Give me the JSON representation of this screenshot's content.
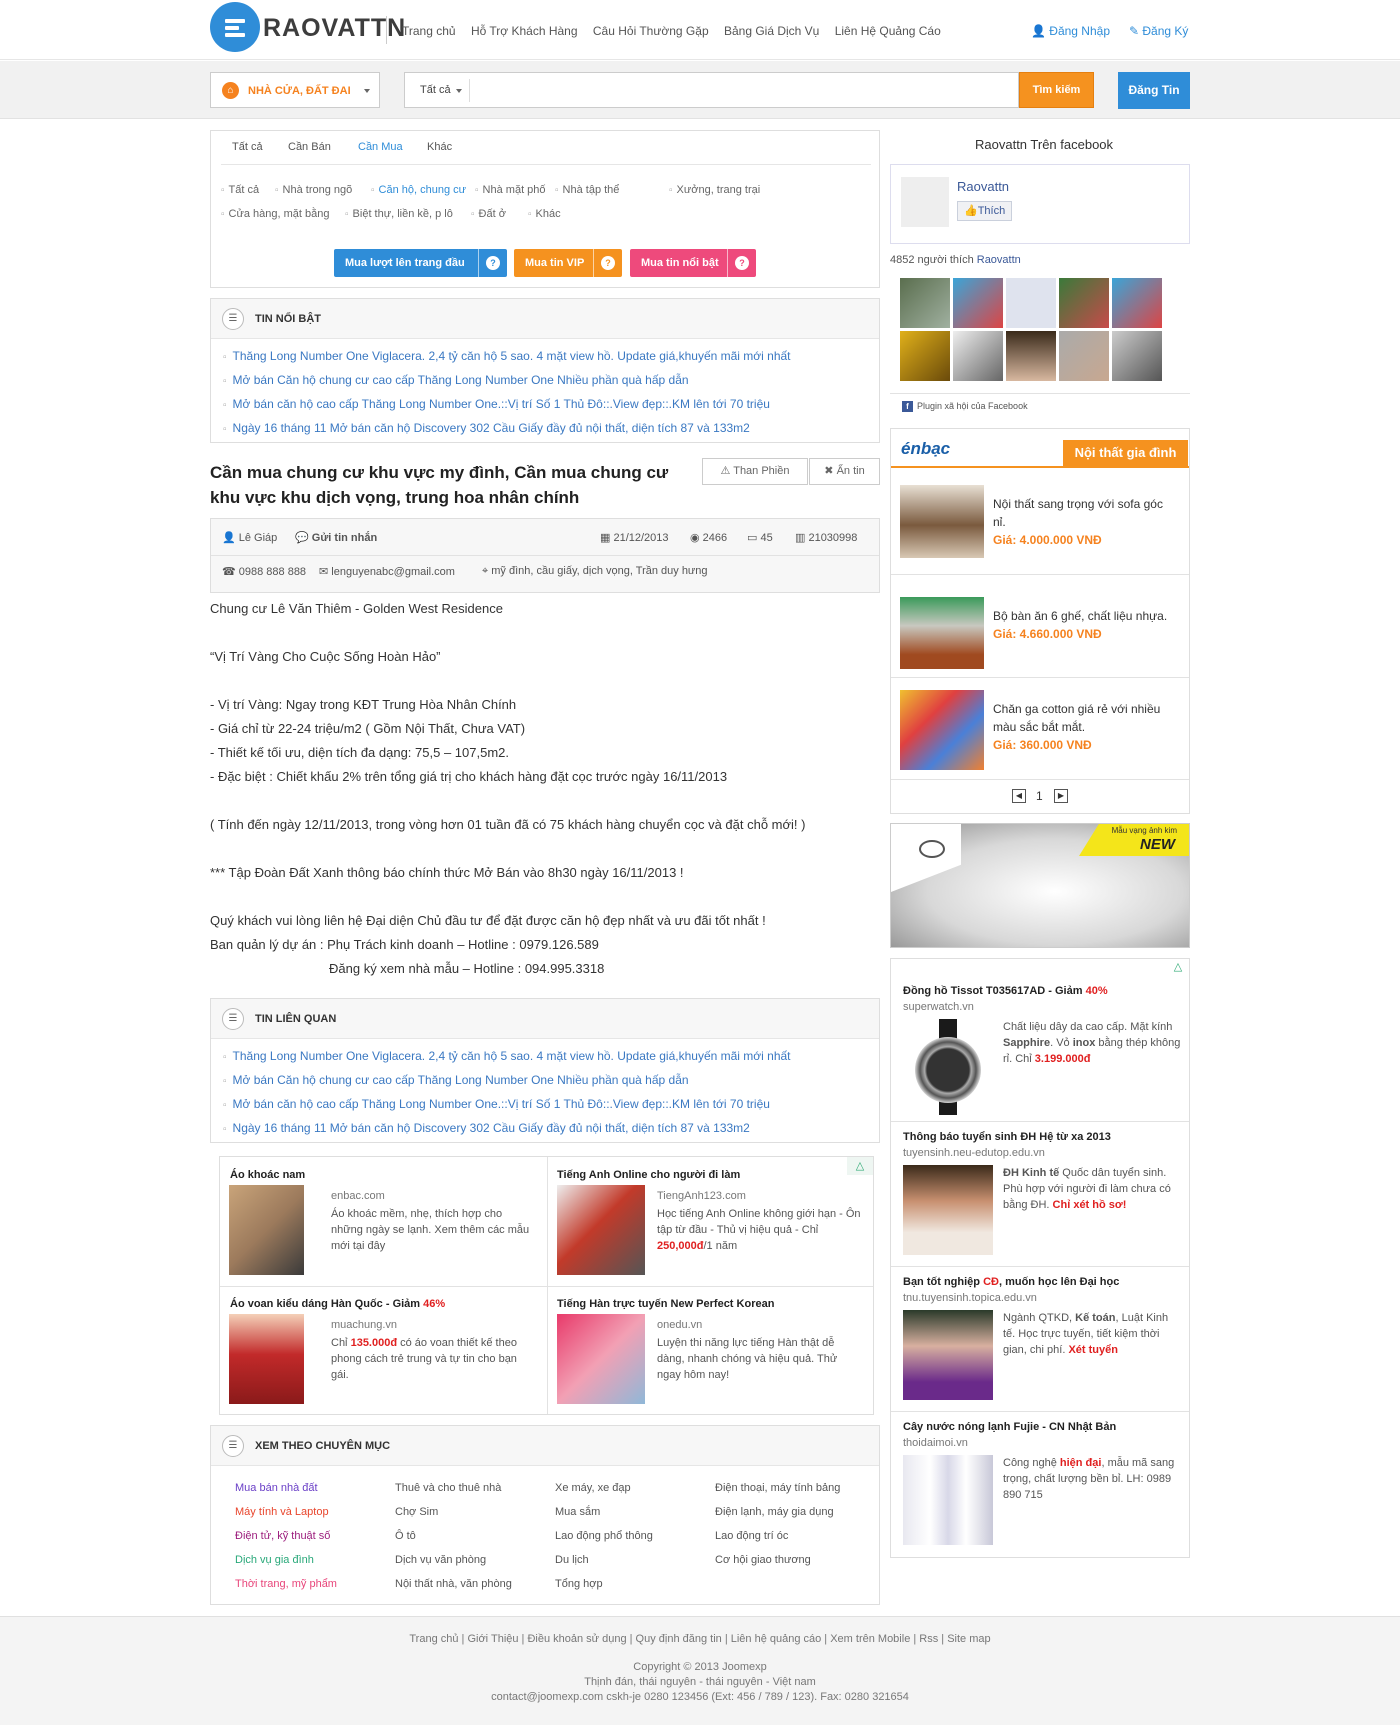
{
  "header": {
    "brand": "RAOVATTN",
    "nav": [
      "Trang chủ",
      "Hỗ Trợ Khách Hàng",
      "Câu Hỏi Thường Gặp",
      "Bảng Giá Dịch Vụ",
      "Liên Hệ Quảng Cáo"
    ],
    "login": "Đăng Nhập",
    "register": "Đăng Ký"
  },
  "search": {
    "category": "NHÀ CỬA, ĐẤT ĐAI",
    "scope": "Tất cả",
    "placeholder": "",
    "button": "Tìm kiếm",
    "post_button": "Đăng Tin"
  },
  "filters": {
    "tabs": [
      "Tất cả",
      "Cần Bán",
      "Cần Mua",
      "Khác"
    ],
    "active_tab": "Cần Mua",
    "chips": [
      "Tất cả",
      "Nhà trong ngõ",
      "Căn hộ, chung cư",
      "Nhà mặt phố",
      "Nhà tập thể",
      "Xưởng, trang trại",
      "Cửa hàng, mặt bằng",
      "Biệt thự, liền kề, p lô",
      "Đất ở",
      "Khác"
    ],
    "active_chip": "Căn hộ, chung cư",
    "actions": [
      "Mua lượt lên trang đầu",
      "Mua tin VIP",
      "Mua tin nổi bật"
    ]
  },
  "featured": {
    "title": "TIN NỔI BẬT",
    "items": [
      "Thăng Long Number One Viglacera. 2,4 tỷ căn hộ 5 sao. 4 mặt view hồ. Update giá,khuyến mãi mới nhất",
      "Mở bán Căn hộ chung cư cao cấp Thăng Long Number One Nhiều phần quà hấp dẫn",
      "Mở bán căn hộ cao cấp Thăng Long Number One.::Vị trí Số 1 Thủ Đô::.View đẹp::.KM lên tới 70 triệu",
      "Ngày 16 tháng 11 Mở bán căn hộ Discovery 302 Cầu Giấy đầy đủ nội thất, diện tích 87 và 133m2"
    ]
  },
  "post": {
    "title": "Cần mua chung cư khu vực my đình, Cần mua chung cư khu vực khu dịch vọng, trung hoa nhân chính",
    "complain": "Than Phiền",
    "hide": "Ẩn tin",
    "author": "Lê Giáp",
    "message": "Gửi tin nhắn",
    "date": "21/12/2013",
    "views": "2466",
    "comments": "45",
    "id": "21030998",
    "phone": "0988 888 888",
    "email": "lenguyenabc@gmail.com",
    "location": "mỹ đình, cầu giấy, dịch vọng, Trần duy hưng",
    "body": [
      "Chung cư Lê Văn Thiêm - Golden West Residence",
      "“Vị Trí Vàng Cho Cuộc Sống Hoàn Hảo”",
      "- Vị trí Vàng: Ngay trong KĐT Trung Hòa Nhân Chính",
      "- Giá chỉ từ 22-24 triệu/m2 ( Gồm Nội Thất, Chưa VAT)",
      "- Thiết kế tối ưu, diện tích đa dạng: 75,5 – 107,5m2.",
      "- Đặc biệt : Chiết khấu 2% trên tổng giá trị cho khách hàng đặt cọc trước ngày 16/11/2013",
      "( Tính đến ngày 12/11/2013, trong vòng hơn 01 tuần  đã có 75 khách hàng chuyển cọc và đặt chỗ mới! )",
      "*** Tập Đoàn Đất Xanh thông báo chính thức Mở Bán vào 8h30 ngày 16/11/2013 !",
      "Quý khách vui lòng liên hệ Đại diện Chủ đầu tư để đặt được căn hộ đẹp nhất và ưu đãi tốt nhất !",
      "Ban quản lý dự án :  Phụ Trách kinh doanh – Hotline :   0979.126.589",
      "Đăng ký xem nhà mẫu – Hotline :   094.995.3318"
    ]
  },
  "related": {
    "title": "TIN LIÊN QUAN",
    "items": [
      "Thăng Long Number One Viglacera. 2,4 tỷ căn hộ 5 sao. 4 mặt view hồ. Update giá,khuyến mãi mới nhất",
      "Mở bán Căn hộ chung cư cao cấp Thăng Long Number One Nhiều phần quà hấp dẫn",
      "Mở bán căn hộ cao cấp Thăng Long Number One.::Vị trí Số 1 Thủ Đô::.View đẹp::.KM lên tới 70 triệu",
      "Ngày 16 tháng 11 Mở bán căn hộ Discovery 302 Cầu Giấy đầy đủ nội thất, diện tích 87 và 133m2"
    ]
  },
  "ads": [
    {
      "title": "Áo khoác nam",
      "url": "enbac.com",
      "text": "Áo khoác mềm, nhẹ, thích hợp cho những ngày se lạnh. Xem thêm các mẫu mới tại đây"
    },
    {
      "title": "Tiếng Anh Online cho người đi làm",
      "url": "TiengAnh123.com",
      "text": "Học tiếng Anh Online không giới hạn - Ôn tập từ đầu - Thủ vị hiệu quả - Chỉ",
      "hl": "250,000đ",
      "tail": "/1 năm"
    },
    {
      "title": "Áo voan kiểu dáng Hàn Quốc - Giảm",
      "badge": "46%",
      "url": "muachung.vn",
      "pre": "Chỉ",
      "hl": "135.000đ",
      "text": "có áo voan thiết kế theo phong cách trẻ trung và tự tin cho bạn gái."
    },
    {
      "title": "Tiếng Hàn trực tuyến New Perfect Korean",
      "url": "onedu.vn",
      "text": "Luyện thi năng lực tiếng Hàn thật dễ dàng, nhanh chóng và hiệu quả. Thử ngay hôm nay!"
    }
  ],
  "categories": {
    "title": "XEM THEO CHUYÊN MỤC",
    "cols": [
      [
        {
          "t": "Mua bán nhà đất",
          "c": "#6a3fc7"
        },
        {
          "t": "Máy tính và Laptop",
          "c": "#e8452c"
        },
        {
          "t": "Điện tử, kỹ thuật số",
          "c": "#9c1d7d"
        },
        {
          "t": "Dịch vụ gia đình",
          "c": "#28a879"
        },
        {
          "t": "Thời trang, mỹ phẩm",
          "c": "#e8457a"
        }
      ],
      [
        {
          "t": "Thuê và cho thuê nhà"
        },
        {
          "t": "Chợ Sim"
        },
        {
          "t": "Ô tô"
        },
        {
          "t": "Dịch vụ văn phòng"
        },
        {
          "t": "Nội thất nhà, văn phòng"
        }
      ],
      [
        {
          "t": "Xe máy, xe đạp"
        },
        {
          "t": "Mua sắm"
        },
        {
          "t": "Lao động phổ thông"
        },
        {
          "t": "Du lịch"
        },
        {
          "t": "Tổng hợp"
        }
      ],
      [
        {
          "t": "Điện thoại, máy tính bảng"
        },
        {
          "t": "Điện lạnh, máy gia dụng"
        },
        {
          "t": "Lao động trí óc"
        },
        {
          "t": "Cơ hội giao thương"
        }
      ]
    ]
  },
  "facebook": {
    "title": "Raovattn Trên facebook",
    "page": "Raovattn",
    "like": "Thích",
    "likes_text": "4852 người thích",
    "likes_page": "Raovattn",
    "plugin": "Plugin xã hội của Facebook"
  },
  "enbac": {
    "brand": "énbạc",
    "tab": "Nội thất gia đình",
    "products": [
      {
        "name": "Nội thất sang trọng với sofa góc nỉ.",
        "price": "Giá: 4.000.000 VNĐ"
      },
      {
        "name": "Bộ bàn ăn 6 ghế, chất liệu nhựa.",
        "price": "Giá: 4.660.000 VNĐ"
      },
      {
        "name": "Chăn ga cotton giá rẻ với nhiều màu sắc bắt mắt.",
        "price": "Giá: 360.000 VNĐ"
      }
    ],
    "page": "1"
  },
  "banner": {
    "text1": "Mẫu vạng ảnh kim",
    "text2": "NEW"
  },
  "side_ads": [
    {
      "title": "Đồng hồ Tissot T035617AD - Giảm",
      "badge": "40%",
      "url": "superwatch.vn",
      "text": "Chất liệu dây da cao cấp. Mặt kính",
      "b1": "Sapphire",
      "text2": ". Vỏ",
      "b2": "inox",
      "text3": "bằng thép không rỉ. Chỉ",
      "hl": "3.199.000đ"
    },
    {
      "title": "Thông báo tuyển sinh ĐH Hệ từ xa 2013",
      "url": "tuyensinh.neu-edutop.edu.vn",
      "b1": "ĐH Kinh tế",
      "text": "Quốc dân tuyển sinh. Phù hợp với người đi làm chưa có bằng ĐH.",
      "hl": "Chỉ xét hồ sơ!"
    },
    {
      "title": "Bạn tốt nghiệp",
      "badge": "CĐ",
      "title2": ", muốn học lên Đại học",
      "url": "tnu.tuyensinh.topica.edu.vn",
      "text": "Ngành QTKD,",
      "b1": "Kế toán",
      "text2": ", Luật Kinh tế. Học trực tuyến, tiết kiệm thời gian, chi phí.",
      "hl": "Xét tuyển"
    },
    {
      "title": "Cây nước nóng lạnh Fujie - CN Nhật Bản",
      "url": "thoidaimoi.vn",
      "pre": "Công nghệ",
      "hl": "hiện đại",
      "text": ", mẫu mã sang trọng, chất lượng bền bỉ. LH: 0989 890 715"
    }
  ],
  "footer": {
    "links": "Trang chủ | Giới Thiệu | Điều khoản sử dụng | Quy định đăng tin | Liên hệ quảng cáo | Xem trên Mobile | Rss | Site map",
    "copyright": "Copyright © 2013 Joomexp",
    "address": "Thịnh đán, thái nguyên - thái nguyên - Việt nam",
    "contact": "contact@joomexp.com   cskh-je   0280 123456 (Ext: 456 / 789 / 123). Fax: 0280 321654"
  }
}
